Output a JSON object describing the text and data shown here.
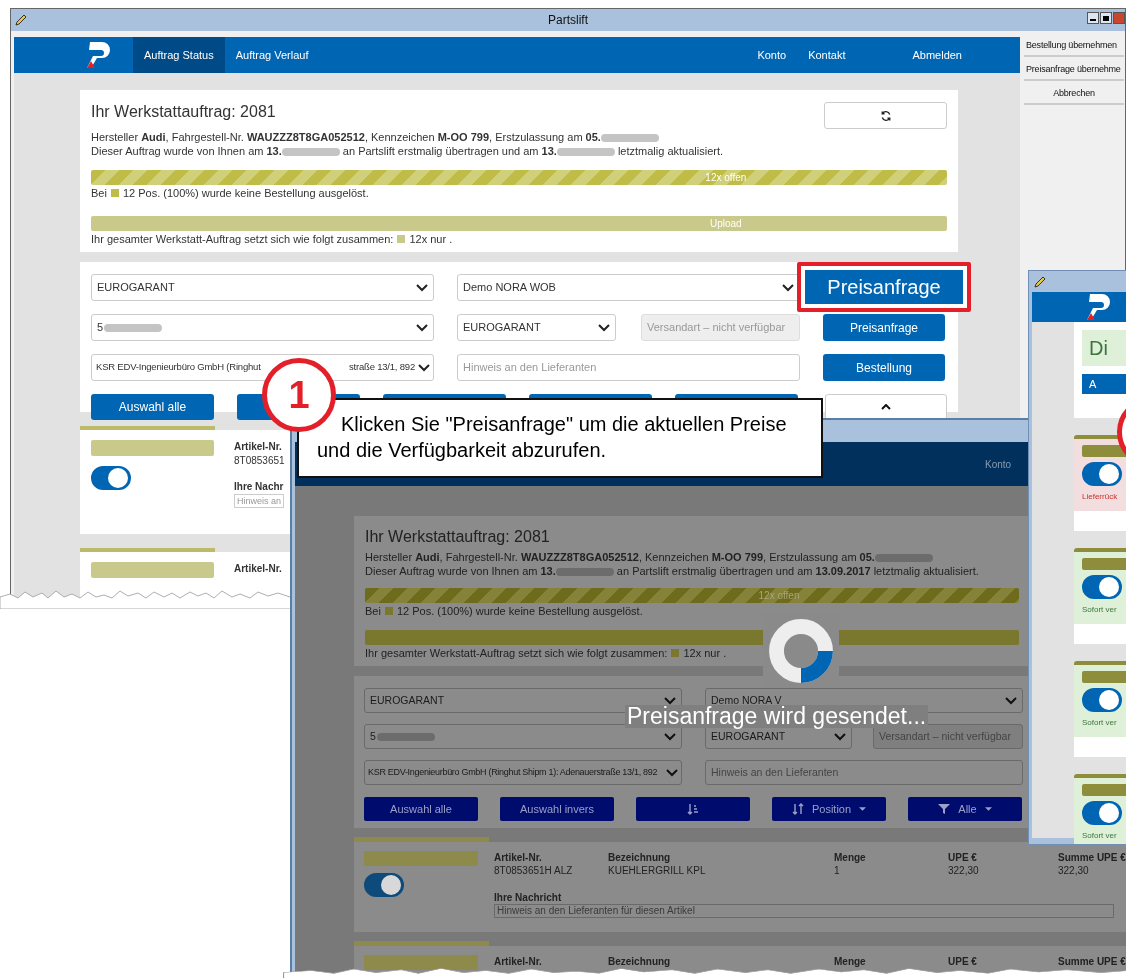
{
  "back_window": {
    "title": "Partslift",
    "tabs": [
      {
        "label": "Auftrag Status",
        "selected": true
      },
      {
        "label": "Auftrag Verlauf",
        "selected": false
      }
    ],
    "nav_links": [
      "Konto",
      "Kontakt",
      "Abmelden"
    ],
    "side_buttons": [
      "Bestellung übernehmen",
      "Preisanfrage übernehme",
      "Abbrechen"
    ],
    "order": {
      "title": "Ihr Werkstattauftrag: 2081",
      "lines": [
        [
          {
            "kind": "text",
            "text": "Hersteller **Audi**, Fahrgestell-Nr. **WAUZZZ8T8GA052512**, Kennzeichen **M-OO 799**, Erstzulassung am **05.**"
          },
          {
            "kind": "redacted"
          }
        ],
        [
          {
            "kind": "text",
            "text": "Dieser Auftrag wurde von Ihnen am **13.**"
          },
          {
            "kind": "redacted"
          },
          {
            "kind": "text",
            "text": " an Partslift erstmalig übertragen und am **13.**"
          },
          {
            "kind": "redacted"
          },
          {
            "kind": "text",
            "text": " letztmalig aktualisiert."
          }
        ]
      ],
      "bars": [
        {
          "label": "12x offen",
          "striped": true,
          "level": 1,
          "legend_before": "Bei",
          "legend_after": "12 Pos. (100%) wurde keine Bestellung ausgelöst."
        },
        {
          "label": "Upload",
          "striped": false,
          "level": 1,
          "legend_before": "Ihr gesamter Werkstatt-Auftrag setzt sich wie folgt zusammen:",
          "legend_after": "12x nur ."
        }
      ]
    },
    "form": {
      "supplier": "EUROGARANT",
      "account": "Demo NORA WOB",
      "customer_number": "5",
      "shipper": "EUROGARANT",
      "shipping": "Versandart – nicht verfügbar",
      "shipping_disabled": true,
      "address": "KSR EDV-Ingenieurbüro GmbH (Ringhut",
      "address_tail": "straße 13/1, 892",
      "note_placeholder": "Hinweis an den Lieferanten",
      "actions": [
        {
          "label": "Preisanfrage",
          "highlighted": true
        },
        {
          "label": "Preisanfrage",
          "highlighted": false
        },
        {
          "label": "Bestellung",
          "highlighted": false
        }
      ],
      "row_buttons": [
        {
          "kind": "text",
          "label": "Auswahl alle"
        },
        {
          "kind": "covered"
        },
        {
          "kind": "covered"
        },
        {
          "kind": "covered"
        },
        {
          "kind": "covered"
        }
      ]
    },
    "items": [
      {
        "on": true,
        "article_label": "Artikel-Nr.",
        "article": "8T0853651",
        "message_label": "Ihre Nachr",
        "placeholder": "Hinweis an"
      },
      {
        "article_label": "Artikel-Nr."
      }
    ]
  },
  "front_window": {
    "nav_link": "Konto",
    "order": {
      "title": "Ihr Werkstattauftrag: 2081",
      "lines": [
        [
          {
            "kind": "text",
            "text": "Hersteller **Audi**, Fahrgestell-Nr. **WAUZZZ8T8GA052512**, Kennzeichen **M-OO 799**, Erstzulassung am **05.**"
          },
          {
            "kind": "redacted"
          }
        ],
        [
          {
            "kind": "text",
            "text": "Dieser Auftrag wurde von Ihnen am **13.**"
          },
          {
            "kind": "redacted"
          },
          {
            "kind": "text",
            "text": " an Partslift erstmalig übertragen und am **13.09.2017** letztmalig aktualisiert."
          }
        ]
      ],
      "bars": [
        {
          "label": "12x offen",
          "striped": true,
          "level": 1,
          "legend_before": "Bei",
          "legend_after": "12 Pos. (100%) wurde keine Bestellung ausgelöst."
        },
        {
          "striped": false,
          "level": 1,
          "legend_before": "Ihr gesamter Werkstatt-Auftrag setzt sich wie folgt zusammen:",
          "legend_after": "12x nur ."
        }
      ]
    },
    "form": {
      "supplier": "EUROGARANT",
      "account": "Demo NORA V",
      "customer_number": "5",
      "shipper": "EUROGARANT",
      "shipping": "Versandart – nicht verfügbar",
      "shipping_disabled": true,
      "address": "KSR EDV-Ingenieurbüro GmbH (Ringhut Shipm 1): Adenauerstraße 13/1, 892",
      "note_placeholder": "Hinweis an den Lieferanten",
      "row_buttons": [
        {
          "kind": "text",
          "label": "Auswahl alle"
        },
        {
          "kind": "text",
          "label": "Auswahl invers"
        },
        {
          "kind": "sort"
        },
        {
          "kind": "sort_menu",
          "label": "Position"
        },
        {
          "kind": "filter_menu",
          "label": "Alle"
        }
      ]
    },
    "items": [
      {
        "on": true,
        "columns": [
          {
            "header": "Artikel-Nr.",
            "value": "8T0853651H ALZ"
          },
          {
            "header": "Bezeichnung",
            "value": "KUEHLERGRILL KPL"
          },
          {
            "header": "Menge",
            "value": "1"
          },
          {
            "header": "UPE €",
            "value": "322,30"
          },
          {
            "header": "Summe UPE €",
            "value": "322,30"
          }
        ],
        "message_label": "Ihre Nachricht",
        "placeholder": "Hinweis an den Lieferanten für diesen Artikel"
      },
      {
        "columns": [
          {
            "header": "Artikel-Nr."
          },
          {
            "header": "Bezeichnung"
          },
          {
            "header": "Menge"
          },
          {
            "header": "UPE €"
          },
          {
            "header": "Summe UPE €"
          }
        ]
      }
    ],
    "loading_text": "Preisanfrage wird gesendet..."
  },
  "right_window": {
    "banner": "Di",
    "button": "A",
    "items": [
      {
        "kind": "warning",
        "on": true,
        "note": "Lieferrück"
      },
      {
        "kind": "ok",
        "on": true,
        "note": "Sofort ver"
      },
      {
        "kind": "ok",
        "on": true,
        "note": "Sofort ver"
      },
      {
        "kind": "ok",
        "on": true,
        "note": "Sofort ver"
      }
    ]
  },
  "callout": {
    "number": "1",
    "text": "Klicken Sie \"Preisanfrage\" um die aktuellen Preise und die Verfügbarkeit abzurufen."
  }
}
